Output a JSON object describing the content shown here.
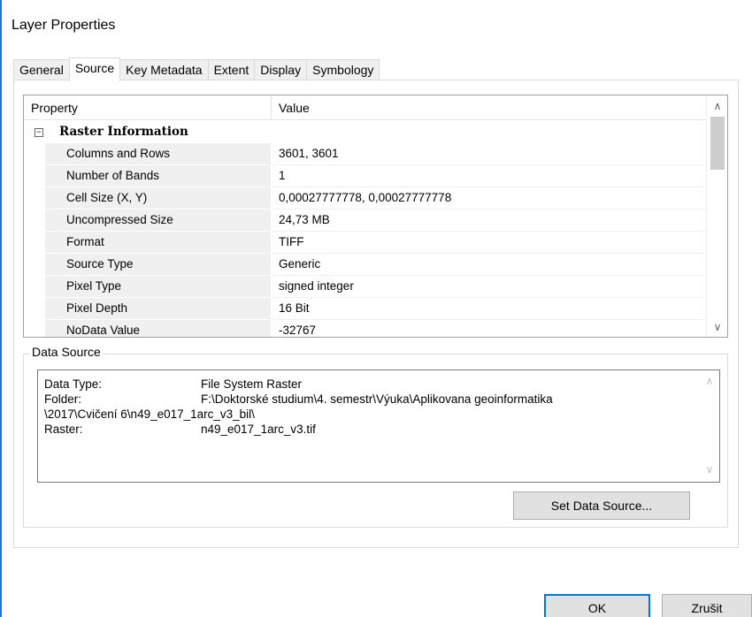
{
  "window": {
    "title": "Layer Properties"
  },
  "tabs": [
    {
      "label": "General",
      "active": false
    },
    {
      "label": "Source",
      "active": true
    },
    {
      "label": "Key Metadata",
      "active": false
    },
    {
      "label": "Extent",
      "active": false
    },
    {
      "label": "Display",
      "active": false
    },
    {
      "label": "Symbology",
      "active": false
    }
  ],
  "grid": {
    "header": {
      "property": "Property",
      "value": "Value"
    },
    "category": {
      "toggle": "−",
      "label": "Raster Information"
    },
    "rows": [
      {
        "name": "Columns and Rows",
        "value": "3601, 3601"
      },
      {
        "name": "Number of Bands",
        "value": "1"
      },
      {
        "name": "Cell Size (X, Y)",
        "value": "0,00027777778, 0,00027777778"
      },
      {
        "name": "Uncompressed Size",
        "value": "24,73 MB"
      },
      {
        "name": "Format",
        "value": "TIFF"
      },
      {
        "name": "Source Type",
        "value": "Generic"
      },
      {
        "name": "Pixel Type",
        "value": "signed integer"
      },
      {
        "name": "Pixel Depth",
        "value": "16 Bit"
      },
      {
        "name": "NoData Value",
        "value": "-32767"
      }
    ],
    "scroll_up": "∧",
    "scroll_down": "∨"
  },
  "data_source": {
    "group_title": "Data Source",
    "type_label": "Data Type:",
    "type_value": "File System Raster",
    "folder_label": "Folder:",
    "folder_value_line1": "F:\\Doktorské studium\\4. semestr\\Výuka\\Aplikovana geoinformatika",
    "folder_value_line2": "\\2017\\Cvičení 6\\n49_e017_1arc_v3_bil\\",
    "raster_label": "Raster:",
    "raster_value": "n49_e017_1arc_v3.tif",
    "scroll_up": "∧",
    "scroll_down": "∨",
    "set_button": "Set Data Source..."
  },
  "footer": {
    "ok": "OK",
    "cancel": "Zrušit"
  },
  "colors": {
    "accent": "#0078d7",
    "window_border": "#1f78d1"
  }
}
